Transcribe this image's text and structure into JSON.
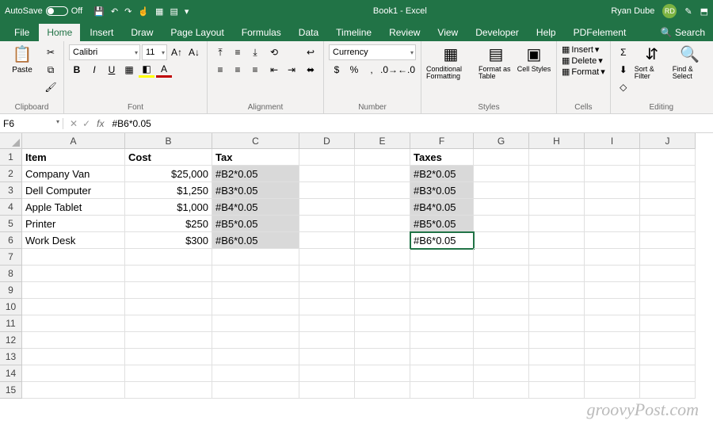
{
  "title": "Book1 - Excel",
  "user": {
    "name": "Ryan Dube",
    "initials": "RD"
  },
  "autosave": {
    "label": "AutoSave",
    "state": "Off"
  },
  "tabs": [
    "File",
    "Home",
    "Insert",
    "Draw",
    "Page Layout",
    "Formulas",
    "Data",
    "Timeline",
    "Review",
    "View",
    "Developer",
    "Help",
    "PDFelement"
  ],
  "active_tab": "Home",
  "search_label": "Search",
  "ribbon": {
    "clipboard": {
      "paste": "Paste",
      "label": "Clipboard"
    },
    "font": {
      "name": "Calibri",
      "size": "11",
      "label": "Font"
    },
    "alignment": {
      "label": "Alignment"
    },
    "number": {
      "format": "Currency",
      "label": "Number"
    },
    "styles": {
      "cond": "Conditional Formatting",
      "table": "Format as Table",
      "cell": "Cell Styles",
      "label": "Styles"
    },
    "cells": {
      "insert": "Insert",
      "delete": "Delete",
      "format": "Format",
      "label": "Cells"
    },
    "editing": {
      "sort": "Sort & Filter",
      "find": "Find & Select",
      "label": "Editing"
    }
  },
  "namebox": "F6",
  "formula": "#B6*0.05",
  "columns": [
    "A",
    "B",
    "C",
    "D",
    "E",
    "F",
    "G",
    "H",
    "I",
    "J"
  ],
  "rows": [
    "1",
    "2",
    "3",
    "4",
    "5",
    "6",
    "7",
    "8",
    "9",
    "10",
    "11",
    "12",
    "13",
    "14",
    "15"
  ],
  "sheet": {
    "headers": {
      "A": "Item",
      "B": "Cost",
      "C": "Tax",
      "F": "Taxes"
    },
    "data": [
      {
        "item": "Company Van",
        "cost": "$25,000",
        "tax": "#B2*0.05",
        "taxes": "#B2*0.05"
      },
      {
        "item": "Dell Computer",
        "cost": "$1,250",
        "tax": "#B3*0.05",
        "taxes": "#B3*0.05"
      },
      {
        "item": "Apple Tablet",
        "cost": "$1,000",
        "tax": "#B4*0.05",
        "taxes": "#B4*0.05"
      },
      {
        "item": "Printer",
        "cost": "$250",
        "tax": "#B5*0.05",
        "taxes": "#B5*0.05"
      },
      {
        "item": "Work Desk",
        "cost": "$300",
        "tax": "#B6*0.05",
        "taxes": "#B6*0.05"
      }
    ]
  },
  "watermark": "groovyPost.com"
}
